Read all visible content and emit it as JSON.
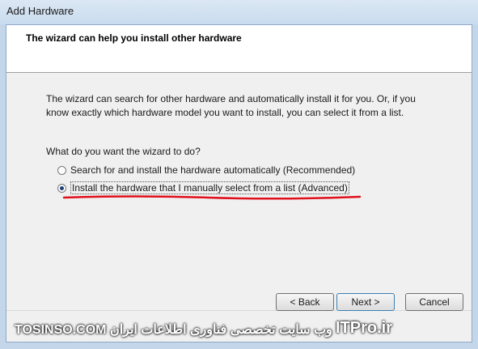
{
  "window": {
    "title": "Add Hardware"
  },
  "header": {
    "title": "The wizard can help you install other hardware"
  },
  "content": {
    "description": "The wizard can search for other hardware and automatically install it for you. Or, if you know exactly which hardware model you want to install, you can select it from a list.",
    "question": "What do you want the wizard to do?",
    "options": [
      {
        "label": "Search for and install the hardware automatically (Recommended)",
        "selected": false
      },
      {
        "label": "Install the hardware that I manually select from a list (Advanced)",
        "selected": true
      }
    ]
  },
  "buttons": {
    "back": "< Back",
    "next": "Next >",
    "cancel": "Cancel"
  },
  "watermark": {
    "site": "TOSINSO.COM",
    "text": "وب سایت تخصصی فناوری اطلاعات ایران",
    "brand": "ITPro.ir"
  },
  "colors": {
    "annotation": "#e0101c",
    "selected_radio": "#1d3f7a"
  }
}
